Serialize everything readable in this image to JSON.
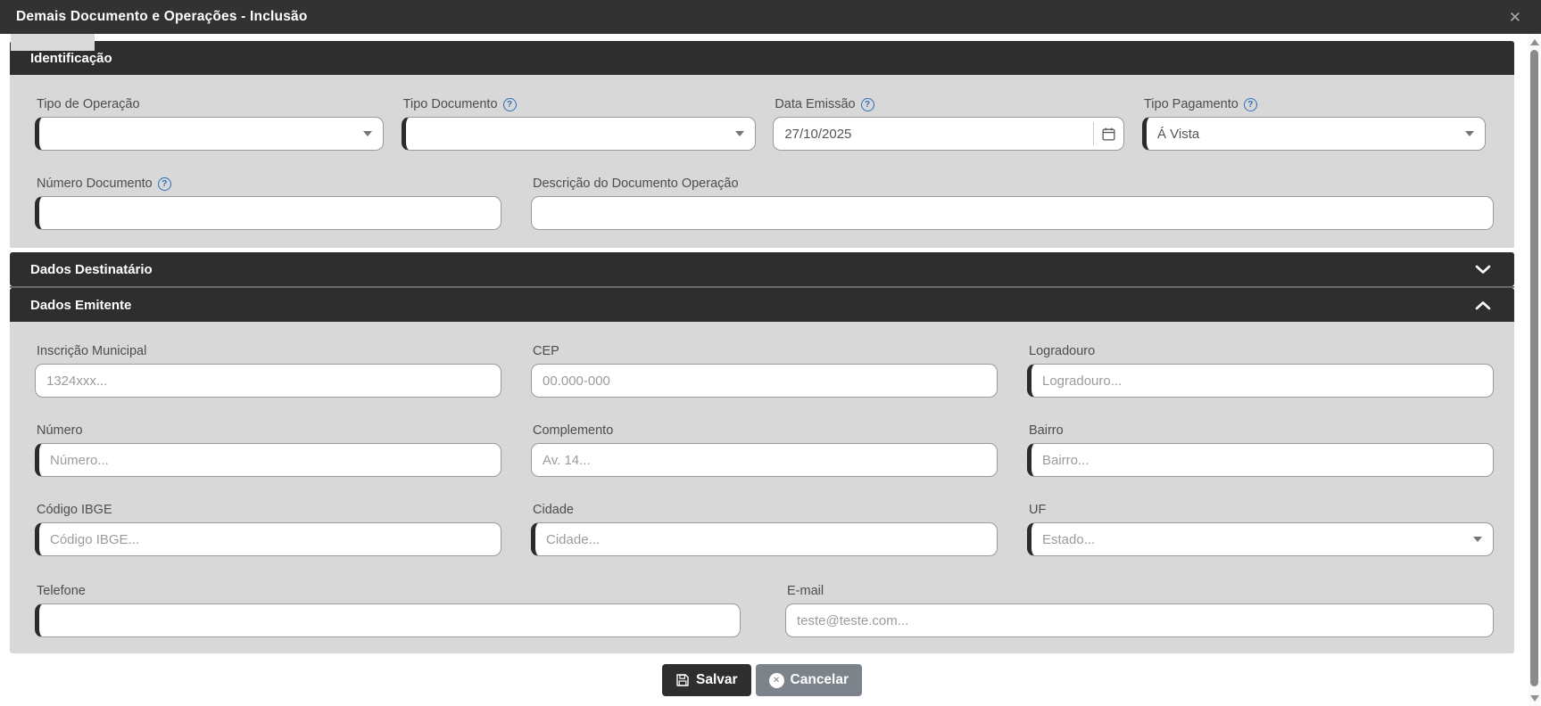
{
  "window": {
    "title": "Demais Documento e Operações - Inclusão",
    "close_glyph": "✕"
  },
  "sections": {
    "identificacao": "Identificação",
    "destinatario": "Dados Destinatário",
    "emitente": "Dados Emitente"
  },
  "icons": {
    "help_glyph": "?",
    "cancel_glyph": "✕"
  },
  "fields": {
    "tipo_operacao": {
      "label": "Tipo de Operação",
      "value": ""
    },
    "tipo_documento": {
      "label": "Tipo Documento",
      "value": ""
    },
    "data_emissao": {
      "label": "Data Emissão",
      "value": "27/10/2025"
    },
    "tipo_pagamento": {
      "label": "Tipo Pagamento",
      "value": "Á Vista"
    },
    "numero_documento": {
      "label": "Número Documento",
      "value": ""
    },
    "descricao": {
      "label": "Descrição do Documento Operação",
      "value": ""
    },
    "inscricao_municipal": {
      "label": "Inscrição Municipal",
      "placeholder": "1324xxx..."
    },
    "cep": {
      "label": "CEP",
      "placeholder": "00.000-000"
    },
    "logradouro": {
      "label": "Logradouro",
      "placeholder": "Logradouro..."
    },
    "numero": {
      "label": "Número",
      "placeholder": "Número..."
    },
    "complemento": {
      "label": "Complemento",
      "placeholder": "Av. 14..."
    },
    "bairro": {
      "label": "Bairro",
      "placeholder": "Bairro..."
    },
    "codigo_ibge": {
      "label": "Código IBGE",
      "placeholder": "Código IBGE..."
    },
    "cidade": {
      "label": "Cidade",
      "placeholder": "Cidade..."
    },
    "uf": {
      "label": "UF",
      "placeholder": "Estado..."
    },
    "telefone": {
      "label": "Telefone",
      "placeholder": ""
    },
    "email": {
      "label": "E-mail",
      "placeholder": "teste@teste.com..."
    }
  },
  "buttons": {
    "save": "Salvar",
    "cancel": "Cancelar"
  },
  "colors": {
    "titlebar_bg": "#323232",
    "section_bg": "#2e2e2e",
    "body_bg": "#d8d8d8",
    "accent_border": "#2b2b2b",
    "help_blue": "#2d6cb5",
    "save_bg": "#2e2e2e",
    "cancel_bg": "#7c838b",
    "input_border": "#9a9a9a",
    "label_color": "#4d4d4d",
    "placeholder_color": "#9b9b9b",
    "value_color": "#555555"
  }
}
